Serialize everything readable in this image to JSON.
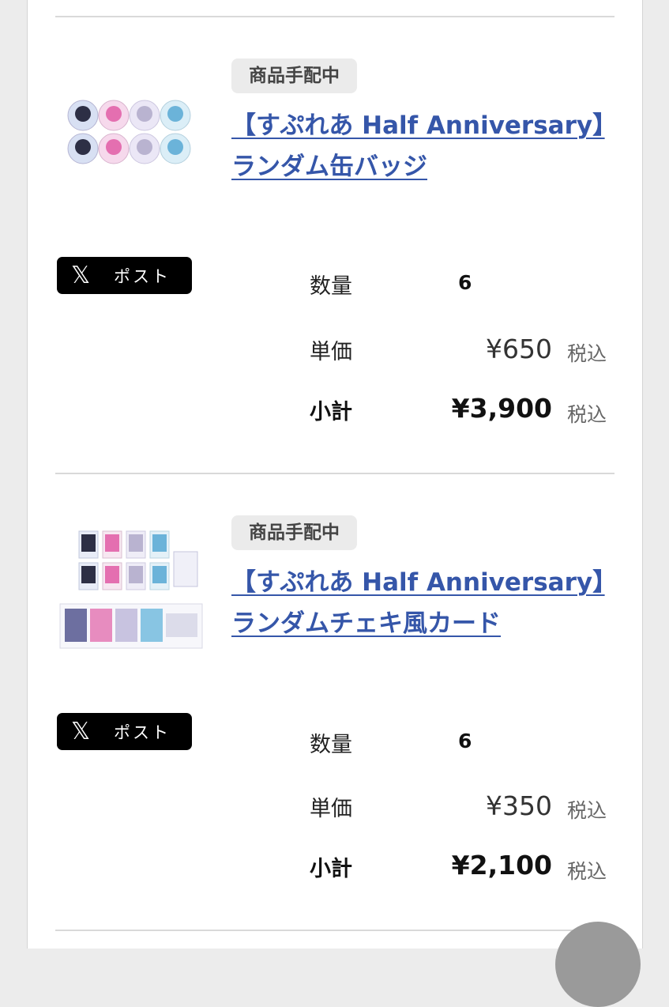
{
  "items": [
    {
      "status": "商品手配中",
      "title": "【すぷれあ Half Anniversary】ランダム缶バッジ",
      "post_label": "ポスト",
      "post_icon": "x-logo-icon",
      "quantity_label": "数量",
      "quantity": "6",
      "unit_price_label": "単価",
      "unit_price": "¥650",
      "unit_tax": "税込",
      "subtotal_label": "小計",
      "subtotal": "¥3,900",
      "subtotal_tax": "税込"
    },
    {
      "status": "商品手配中",
      "title": "【すぷれあ Half Anniversary】ランダムチェキ風カード",
      "post_label": "ポスト",
      "post_icon": "x-logo-icon",
      "quantity_label": "数量",
      "quantity": "6",
      "unit_price_label": "単価",
      "unit_price": "¥350",
      "unit_tax": "税込",
      "subtotal_label": "小計",
      "subtotal": "¥2,100",
      "subtotal_tax": "税込"
    }
  ],
  "colors": {
    "link": "#3556a9",
    "badge_bg": "#ebebeb",
    "post_bg": "#000000"
  }
}
